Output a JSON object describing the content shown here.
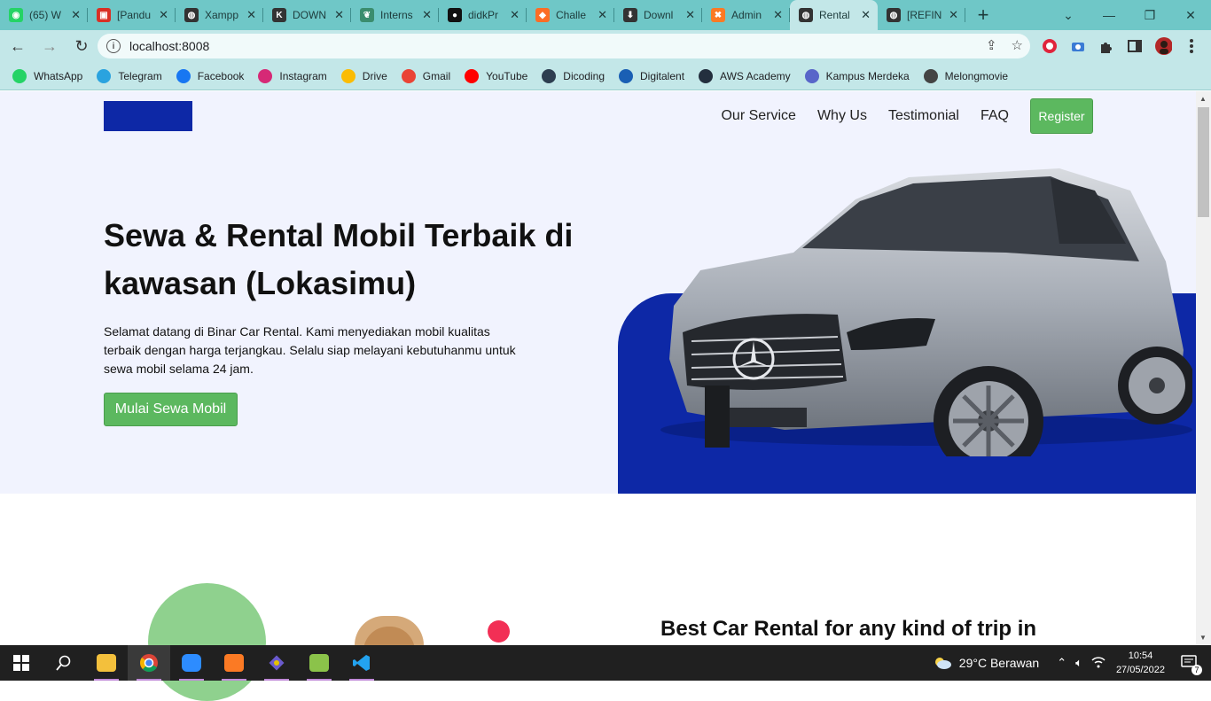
{
  "browser": {
    "tabs": [
      {
        "title": "(65) W",
        "icon": "whatsapp-icon",
        "color": "#25d366",
        "glyph": "◉"
      },
      {
        "title": "[Pandu",
        "icon": "pdf-icon",
        "color": "#d93025",
        "glyph": "▣"
      },
      {
        "title": "Xampp",
        "icon": "globe-icon",
        "color": "#333333",
        "glyph": "◍"
      },
      {
        "title": "DOWN",
        "icon": "kb-icon",
        "color": "#333333",
        "glyph": "K"
      },
      {
        "title": "Interns",
        "icon": "leaf-icon",
        "color": "#3b8d6e",
        "glyph": "❦"
      },
      {
        "title": "didkPr",
        "icon": "github-icon",
        "color": "#111111",
        "glyph": "●"
      },
      {
        "title": "Challe",
        "icon": "gitlab-icon",
        "color": "#fc6d26",
        "glyph": "◆"
      },
      {
        "title": "Downl",
        "icon": "download-icon",
        "color": "#333333",
        "glyph": "⬇"
      },
      {
        "title": "Admin",
        "icon": "xampp-icon",
        "color": "#fb7a24",
        "glyph": "✖"
      },
      {
        "title": "Rental",
        "icon": "globe-icon",
        "color": "#333333",
        "glyph": "◍",
        "active": true
      },
      {
        "title": "[REFIN",
        "icon": "globe-icon",
        "color": "#333333",
        "glyph": "◍"
      }
    ],
    "close_glyph": "✕",
    "new_tab_glyph": "+",
    "window_controls": {
      "dropdown": "⌄",
      "minimize": "—",
      "restore": "❐",
      "close": "✕"
    },
    "url": "localhost:8008",
    "nav": {
      "back": "←",
      "forward": "→",
      "reload": "↻",
      "info": "i",
      "share": "⇪",
      "star": "☆"
    },
    "bookmarks": [
      {
        "label": "WhatsApp",
        "icon": "whatsapp-icon",
        "color": "#25d366"
      },
      {
        "label": "Telegram",
        "icon": "telegram-icon",
        "color": "#2aa3df"
      },
      {
        "label": "Facebook",
        "icon": "facebook-icon",
        "color": "#1877f2"
      },
      {
        "label": "Instagram",
        "icon": "instagram-icon",
        "color": "#d62976"
      },
      {
        "label": "Drive",
        "icon": "drive-icon",
        "color": "#fbbc04"
      },
      {
        "label": "Gmail",
        "icon": "gmail-icon",
        "color": "#ea4335"
      },
      {
        "label": "YouTube",
        "icon": "youtube-icon",
        "color": "#ff0000"
      },
      {
        "label": "Dicoding",
        "icon": "dicoding-icon",
        "color": "#2d3e50"
      },
      {
        "label": "Digitalent",
        "icon": "digitalent-icon",
        "color": "#1a5fb4"
      },
      {
        "label": "AWS Academy",
        "icon": "aws-icon",
        "color": "#232f3e"
      },
      {
        "label": "Kampus Merdeka",
        "icon": "kampus-merdeka-icon",
        "color": "#5865c9"
      },
      {
        "label": "Melongmovie",
        "icon": "melongmovie-icon",
        "color": "#444444"
      }
    ]
  },
  "page": {
    "nav_links": [
      "Our Service",
      "Why Us",
      "Testimonial",
      "FAQ"
    ],
    "register_label": "Register",
    "hero_title": "Sewa & Rental Mobil Terbaik di kawasan (Lokasimu)",
    "hero_description": "Selamat datang di Binar Car Rental. Kami menyediakan mobil kualitas terbaik dengan harga terjangkau. Selalu siap melayani kebutuhanmu untuk sewa mobil selama 24 jam.",
    "cta_label": "Mulai Sewa Mobil",
    "section2_title": "Best Car Rental for any kind of trip in",
    "colors": {
      "brand_blue": "#0d28a6",
      "green": "#5cb85f",
      "hero_bg": "#f1f3fe",
      "accent_red": "#f22f55",
      "circle_green": "#8fd18e"
    }
  },
  "taskbar": {
    "apps": [
      "start-icon",
      "search-icon",
      "file-explorer-icon",
      "chrome-icon",
      "zoom-icon",
      "xampp-icon",
      "git-icon",
      "notepad-icon",
      "vscode-icon"
    ],
    "weather": "29°C  Berawan",
    "time": "10:54",
    "date": "27/05/2022",
    "notifications": "7"
  }
}
